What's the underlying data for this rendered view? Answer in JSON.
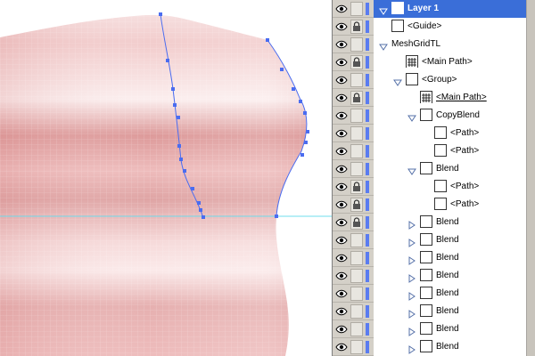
{
  "layers_panel": {
    "rows": [
      {
        "label": "Layer 1",
        "indent": 0,
        "selected": true,
        "expand": "down",
        "thumb": "layer",
        "lock": false,
        "target": "ring",
        "select_mark": "small",
        "underline": false
      },
      {
        "label": "<Guide>",
        "indent": 0,
        "selected": false,
        "expand": "none",
        "thumb": "box",
        "lock": true,
        "target": "ring",
        "select_mark": "none",
        "underline": false
      },
      {
        "label": "MeshGridTL",
        "indent": 0,
        "selected": false,
        "expand": "down",
        "thumb": "none",
        "lock": false,
        "target": "ring",
        "select_mark": "small",
        "underline": false
      },
      {
        "label": "<Main Path>",
        "indent": 1,
        "selected": false,
        "expand": "none",
        "thumb": "mesh",
        "lock": true,
        "target": "ring",
        "select_mark": "none",
        "underline": false
      },
      {
        "label": "<Group>",
        "indent": 1,
        "selected": false,
        "expand": "down",
        "thumb": "box",
        "lock": false,
        "target": "ring",
        "select_mark": "small",
        "underline": false
      },
      {
        "label": "<Main Path>",
        "indent": 2,
        "selected": false,
        "expand": "none",
        "thumb": "mesh",
        "lock": true,
        "target": "ring",
        "select_mark": "none",
        "underline": true
      },
      {
        "label": "CopyBlend",
        "indent": 2,
        "selected": false,
        "expand": "down",
        "thumb": "box",
        "lock": false,
        "target": "shaded",
        "select_mark": "big",
        "underline": false
      },
      {
        "label": "<Path>",
        "indent": 3,
        "selected": false,
        "expand": "none",
        "thumb": "box",
        "lock": false,
        "target": "ring",
        "select_mark": "big",
        "underline": false
      },
      {
        "label": "<Path>",
        "indent": 3,
        "selected": false,
        "expand": "none",
        "thumb": "box",
        "lock": false,
        "target": "ring",
        "select_mark": "big",
        "underline": false
      },
      {
        "label": "Blend",
        "indent": 2,
        "selected": false,
        "expand": "down",
        "thumb": "box",
        "lock": false,
        "target": "shaded",
        "select_mark": "none",
        "underline": false
      },
      {
        "label": "<Path>",
        "indent": 3,
        "selected": false,
        "expand": "none",
        "thumb": "box",
        "lock": true,
        "target": "ring",
        "select_mark": "none",
        "underline": false
      },
      {
        "label": "<Path>",
        "indent": 3,
        "selected": false,
        "expand": "none",
        "thumb": "box",
        "lock": true,
        "target": "ring",
        "select_mark": "none",
        "underline": false
      },
      {
        "label": "Blend",
        "indent": 2,
        "selected": false,
        "expand": "right",
        "thumb": "box",
        "lock": true,
        "target": "shaded",
        "select_mark": "none",
        "underline": false
      },
      {
        "label": "Blend",
        "indent": 2,
        "selected": false,
        "expand": "right",
        "thumb": "box",
        "lock": false,
        "target": "shaded",
        "select_mark": "none",
        "underline": false
      },
      {
        "label": "Blend",
        "indent": 2,
        "selected": false,
        "expand": "right",
        "thumb": "box",
        "lock": false,
        "target": "shaded",
        "select_mark": "none",
        "underline": false
      },
      {
        "label": "Blend",
        "indent": 2,
        "selected": false,
        "expand": "right",
        "thumb": "box",
        "lock": false,
        "target": "shaded",
        "select_mark": "none",
        "underline": false
      },
      {
        "label": "Blend",
        "indent": 2,
        "selected": false,
        "expand": "right",
        "thumb": "box",
        "lock": false,
        "target": "shaded",
        "select_mark": "none",
        "underline": false
      },
      {
        "label": "Blend",
        "indent": 2,
        "selected": false,
        "expand": "right",
        "thumb": "box",
        "lock": false,
        "target": "shaded",
        "select_mark": "none",
        "underline": false
      },
      {
        "label": "Blend",
        "indent": 2,
        "selected": false,
        "expand": "right",
        "thumb": "box",
        "lock": false,
        "target": "shaded",
        "select_mark": "none",
        "underline": false
      },
      {
        "label": "Blend",
        "indent": 2,
        "selected": false,
        "expand": "right",
        "thumb": "box",
        "lock": false,
        "target": "shaded",
        "select_mark": "none",
        "underline": false
      }
    ]
  },
  "colors": {
    "selection_blue": "#3a6ed8",
    "layer_color": "#5a7cf0",
    "guide_cyan": "#6fdcec",
    "mesh_fill": "#e7a8a8",
    "path_blue": "#4a6cf0"
  },
  "icons": {
    "visibility": "eye-icon",
    "lock": "lock-icon",
    "expand": "triangle-icon",
    "target": "target-circle-icon"
  }
}
